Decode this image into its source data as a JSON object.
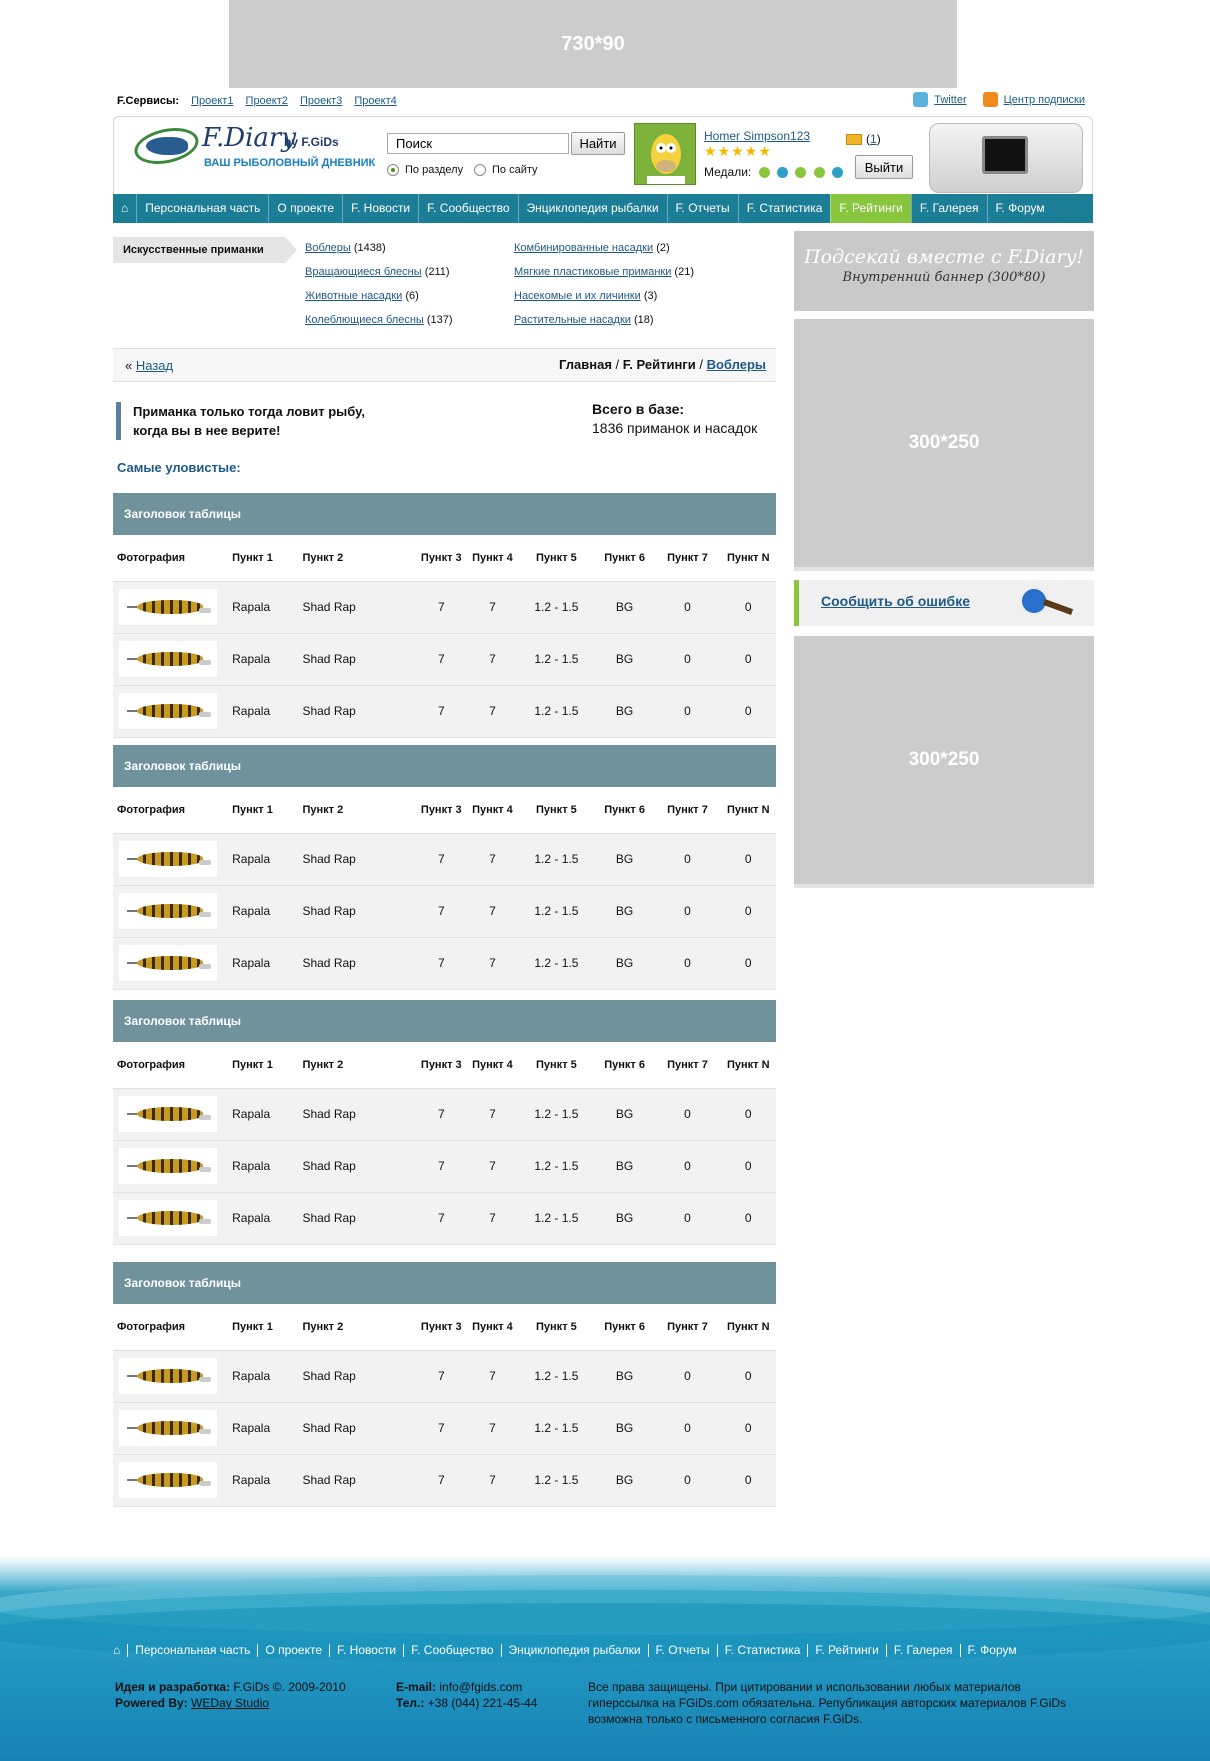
{
  "top_ad": "730*90",
  "services": {
    "label": "F.Сервисы:",
    "links": [
      "Проект1",
      "Проект2",
      "Проект3",
      "Проект4"
    ]
  },
  "toplinks": {
    "twitter": "Twitter",
    "subscribe": "Центр подписки"
  },
  "logo": {
    "title": "F.Diary",
    "by": "by F.GiDs",
    "subtitle": "ВАШ РЫБОЛОВНЫЙ ДНЕВНИК"
  },
  "search": {
    "value": "Поиск",
    "button": "Найти",
    "option1": "По разделу",
    "option2": "По сайту"
  },
  "user": {
    "name": "Homer Simpson123",
    "stars": "★★★★★",
    "medals_label": "Медали:",
    "messages_open": "(",
    "messages_count": "1",
    "messages_close": ")",
    "logout": "Выйти"
  },
  "nav": {
    "items": [
      "Персональная часть",
      "О проекте",
      "F. Новости",
      "F. Сообщество",
      "Энциклопедия рыбалки",
      "F. Отчеты",
      "F. Статистика",
      "F. Рейтинги",
      "F. Галерея",
      "F. Форум"
    ]
  },
  "category": {
    "label": "Искусственные приманки",
    "col1": [
      {
        "name": "Воблеры",
        "count": "(1438)"
      },
      {
        "name": "Вращающиеся блесны",
        "count": "(211)"
      },
      {
        "name": "Животные насадки",
        "count": "(6)"
      },
      {
        "name": "Колеблющиеся блесны",
        "count": "(137)"
      }
    ],
    "col2": [
      {
        "name": "Комбинированные насадки",
        "count": "(2)"
      },
      {
        "name": "Мягкие пластиковые приманки",
        "count": "(21)"
      },
      {
        "name": "Насекомые и их личинки",
        "count": "(3)"
      },
      {
        "name": "Растительные насадки",
        "count": "(18)"
      }
    ]
  },
  "breadcrumb": {
    "back_prefix": "«",
    "back": "Назад",
    "home": "Главная",
    "sep": "/",
    "ratings": "F. Рейтинги",
    "current": "Воблеры"
  },
  "quote": {
    "line1": "Приманка только тогда ловит рыбу,",
    "line2": "когда вы в нее верите!"
  },
  "total": {
    "label": "Всего в базе:",
    "value": "1836 приманок и насадок"
  },
  "best_label": "Самые уловистые:",
  "table": {
    "title": "Заголовок таблицы",
    "columns": [
      "Фотография",
      "Пункт 1",
      "Пункт 2",
      "Пункт 3",
      "Пункт 4",
      "Пункт 5",
      "Пункт 6",
      "Пункт 7",
      "Пункт N"
    ],
    "row": [
      "Rapala",
      "Shad Rap",
      "7",
      "7",
      "1.2 - 1.5",
      "BG",
      "0",
      "0"
    ]
  },
  "right": {
    "banner_line1": "Подсекай вместе с F.Diary!",
    "banner_line2": "Внутренний баннер (300*80)",
    "ad1": "300*250",
    "report": "Сообщить об ошибке",
    "ad2": "300*250"
  },
  "footer": {
    "nav": [
      "Персональная часть",
      "О проекте",
      "F. Новости",
      "F. Сообщество",
      "Энциклопедия рыбалки",
      "F. Отчеты",
      "F. Статистика",
      "F. Рейтинги",
      "F. Галерея",
      "F. Форум"
    ],
    "idea_label": "Идея и разработка:",
    "idea_value": "F.GiDs ©. 2009-2010",
    "powered_label": "Powered By:",
    "powered_value": "WEDay Studio",
    "email_label": "E-mail:",
    "email_value": "info@fgids.com",
    "phone_label": "Тел.:",
    "phone_value": "+38 (044) 221-45-44",
    "copyright": "Все права защищены. При цитировании и использовании любых материалов гиперссылка на FGiDs.com обязательна. Републикация авторских материалов F.GiDs возможна только с письменного согласия F.GiDs."
  },
  "colors": {
    "nav": "#1b7e96",
    "nav_active": "#8ac53e",
    "table_header": "#6f929c",
    "link": "#1d5a8a"
  }
}
